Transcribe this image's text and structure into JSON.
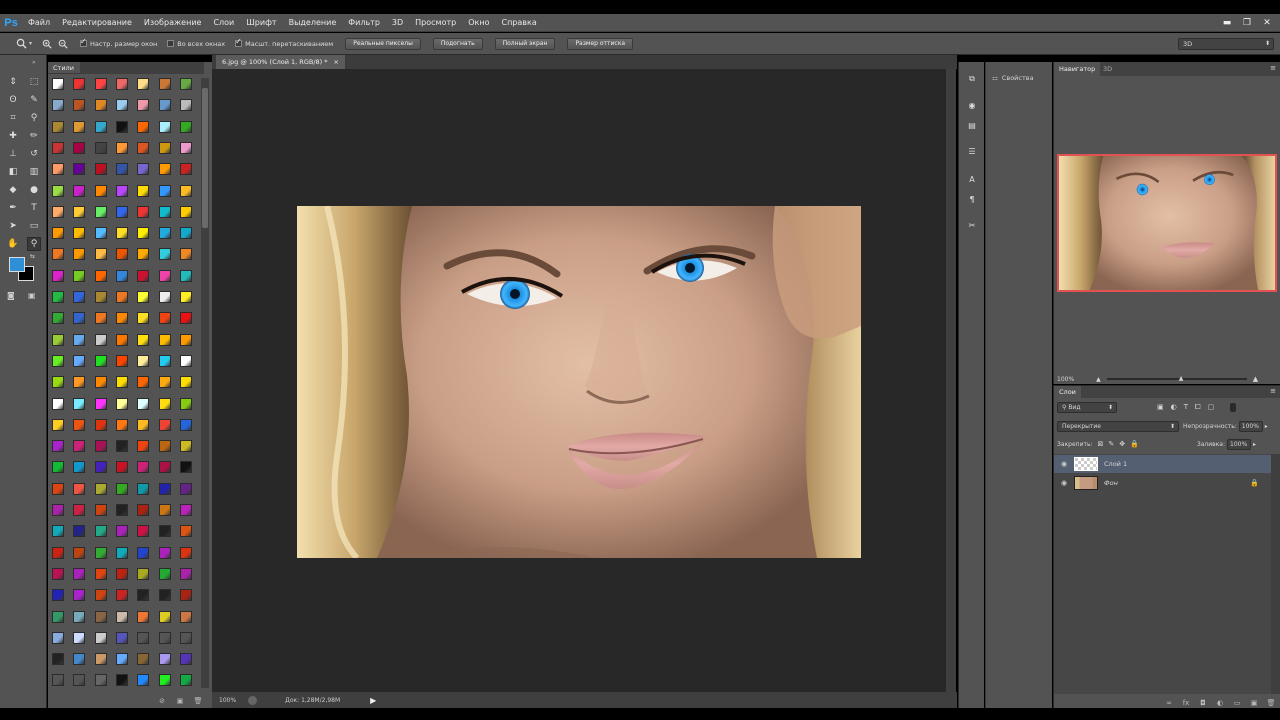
{
  "app": {
    "logo": "Ps"
  },
  "menu": [
    "Файл",
    "Редактирование",
    "Изображение",
    "Слои",
    "Шрифт",
    "Выделение",
    "Фильтр",
    "3D",
    "Просмотр",
    "Окно",
    "Справка"
  ],
  "window_controls": {
    "minimize": "▬",
    "restore": "❐",
    "close": "✕"
  },
  "options": {
    "resize_windows": "Настр. размер окон",
    "all_windows": "Во всех окнах",
    "scrubby_zoom": "Масшт. перетаскиванием",
    "actual_pixels": "Реальные пикселы",
    "fit_screen": "Подогнать",
    "fill_screen": "Полный экран",
    "print_size": "Размер оттиска",
    "workspace": "3D"
  },
  "styles_panel": {
    "title": "Стили"
  },
  "document": {
    "tab_title": "6.jpg @ 100% (Слой 1, RGB/8) *",
    "close": "×"
  },
  "status": {
    "zoom": "100%",
    "doc_size": "Док: 1,28M/2,98M"
  },
  "properties": {
    "title": "Свойства"
  },
  "navigator": {
    "tab_navigator": "Навигатор",
    "tab_3d": "3D",
    "zoom": "100%"
  },
  "layers": {
    "title": "Слои",
    "filter": "Вид",
    "blend_mode": "Перекрытие",
    "opacity_label": "Непрозрачность:",
    "opacity_value": "100%",
    "lock_label": "Закрепить:",
    "fill_label": "Заливка:",
    "fill_value": "100%",
    "items": [
      {
        "name": "Слой 1",
        "selected": true
      },
      {
        "name": "Фон",
        "locked": true
      }
    ]
  },
  "colors": {
    "foreground": "#2f8fd6",
    "background": "#000000",
    "accent": "#31a8ff"
  }
}
